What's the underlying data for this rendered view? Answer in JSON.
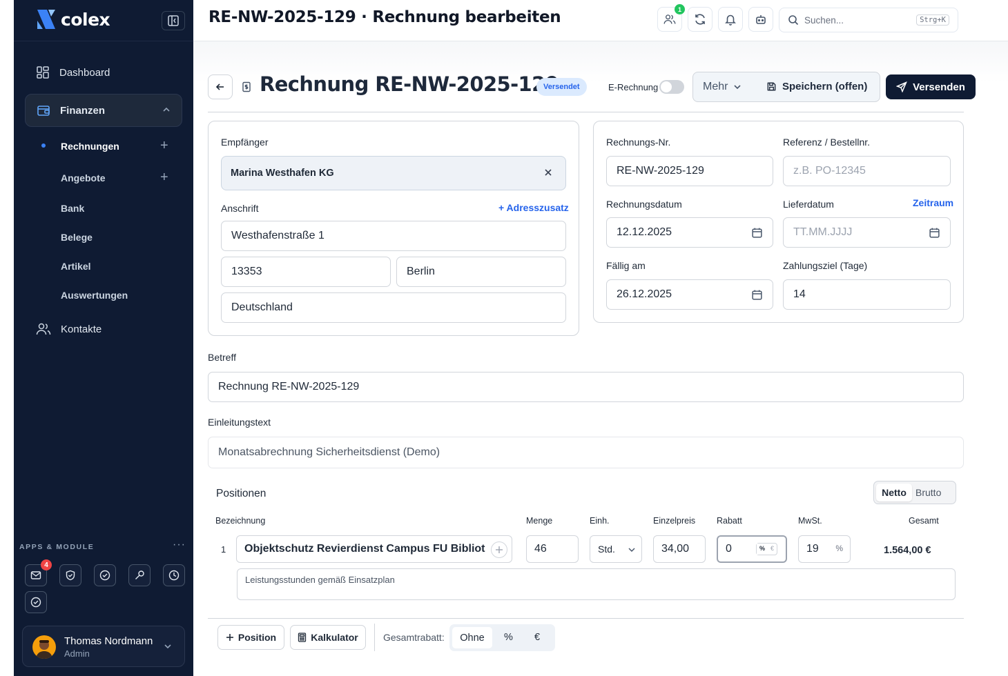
{
  "app": {
    "brand": "colex"
  },
  "sidebar": {
    "nav": [
      {
        "label": "Dashboard",
        "icon": "dashboard-grid-icon"
      },
      {
        "label": "Finanzen",
        "icon": "wallet-icon",
        "expanded": true
      },
      {
        "label": "Kontakte",
        "icon": "users-icon"
      }
    ],
    "finanzen_sub": [
      {
        "label": "Rechnungen",
        "current": true,
        "has_add": true
      },
      {
        "label": "Angebote",
        "has_add": true
      },
      {
        "label": "Bank"
      },
      {
        "label": "Belege"
      },
      {
        "label": "Artikel"
      },
      {
        "label": "Auswertungen"
      }
    ],
    "apps_label": "APPS & MODULE",
    "apps_more": "···",
    "apps": [
      {
        "icon": "mail-icon",
        "badge": "4"
      },
      {
        "icon": "shield-check-icon"
      },
      {
        "icon": "circle-check-icon"
      },
      {
        "icon": "wrench-icon"
      },
      {
        "icon": "clock-icon"
      },
      {
        "icon": "circle-check-icon"
      }
    ],
    "user": {
      "name": "Thomas Nordmann",
      "role": "Admin"
    }
  },
  "topbar": {
    "title": "RE-NW-2025-129 · Rechnung bearbeiten",
    "users_badge": "1",
    "search_placeholder": "Suchen...",
    "search_shortcut": "Strg+K"
  },
  "header": {
    "title": "Rechnung RE-NW-2025-129",
    "status": "Versendet",
    "erechnung_label": "E-Rechnung",
    "erechnung_enabled": false,
    "mehr_label": "Mehr",
    "save_label": "Speichern (offen)",
    "send_label": "Versenden"
  },
  "recipient": {
    "label": "Empfänger",
    "value": "Marina Westhafen KG",
    "address_label": "Anschrift",
    "address_extra_link": "+ Adresszusatz",
    "street": "Westhafenstraße 1",
    "zip": "13353",
    "city": "Berlin",
    "country": "Deutschland"
  },
  "meta": {
    "invoice_no_label": "Rechnungs-Nr.",
    "invoice_no": "RE-NW-2025-129",
    "reference_label": "Referenz / Bestellnr.",
    "reference_placeholder": "z.B. PO-12345",
    "invoice_date_label": "Rechnungsdatum",
    "invoice_date": "12.12.2025",
    "delivery_date_label": "Lieferdatum",
    "delivery_range_link": "Zeitraum",
    "delivery_date_placeholder": "TT.MM.JJJJ",
    "due_label": "Fällig am",
    "due_date": "26.12.2025",
    "terms_label": "Zahlungsziel (Tage)",
    "terms_days": "14"
  },
  "subject": {
    "label": "Betreff",
    "value": "Rechnung RE-NW-2025-129"
  },
  "intro": {
    "label": "Einleitungstext",
    "value": "Monatsabrechnung Sicherheitsdienst (Demo)"
  },
  "positions": {
    "title": "Positionen",
    "mode_options": [
      "Netto",
      "Brutto"
    ],
    "mode_selected": "Netto",
    "columns": {
      "name": "Bezeichnung",
      "qty": "Menge",
      "unit": "Einh.",
      "price": "Einzelpreis",
      "discount": "Rabatt",
      "vat": "MwSt.",
      "total": "Gesamt"
    },
    "items": [
      {
        "num": "1",
        "name": "Objektschutz Revierdienst Campus FU Bibliot",
        "qty": "46",
        "unit": "Std.",
        "price": "34,00",
        "discount": "0",
        "discount_types": [
          "%",
          "€"
        ],
        "vat": "19",
        "vat_suffix": "%",
        "total": "1.564,00 €",
        "description": "Leistungsstunden gemäß Einsatzplan"
      }
    ]
  },
  "footer": {
    "add_position": "Position",
    "calculator": "Kalkulator",
    "total_discount_label": "Gesamtrabatt:",
    "discount_options": [
      "Ohne",
      "%",
      "€"
    ],
    "discount_selected": "Ohne"
  }
}
